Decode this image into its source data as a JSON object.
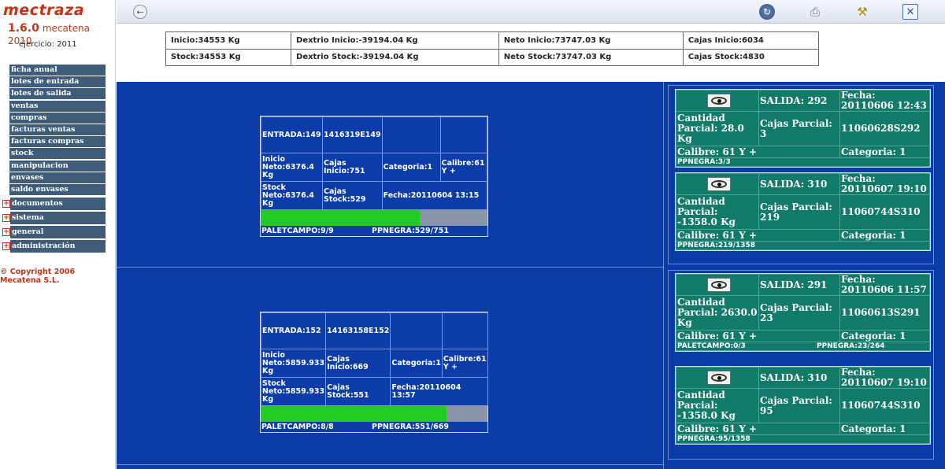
{
  "app": {
    "logo": "mectraza",
    "version": "1.6.0",
    "edition": "mecatena 2010",
    "ejercicio": "ejercicio: 2011"
  },
  "menu": {
    "items": [
      "ficha anual",
      "lotes de entrada",
      "lotes de salida",
      "ventas",
      "compras",
      "facturas ventas",
      "facturas compras",
      "stock",
      "manipulacion",
      "envases",
      "saldo envases"
    ],
    "groups": [
      "documentos",
      "sistema",
      "general",
      "administración"
    ]
  },
  "copyright": {
    "line1": "© Copyright 2006",
    "line2": "Mecatena S.L."
  },
  "summary": {
    "row1": [
      "Inicio:34553 Kg",
      "Dextrio Inicio:-39194.04 Kg",
      "Neto Inicio:73747.03 Kg",
      "Cajas Inicio:6034"
    ],
    "row2": [
      "Stock:34553 Kg",
      "Dextrio Stock:-39194.04 Kg",
      "Neto Stock:73747.03 Kg",
      "Cajas Stock:4830"
    ]
  },
  "entradas": [
    {
      "entrada": "ENTRADA:149",
      "codigo": "1416319E149",
      "inicio_neto": "Inicio Neto:6376.4 Kg",
      "cajas_inicio": "Cajas Inicio:751",
      "categoria": "Categoria:1",
      "calibre": "Calibre:61 Y +",
      "stock_neto": "Stock Neto:6376.4 Kg",
      "cajas_stock": "Cajas Stock:529",
      "fecha": "Fecha:20110604 13:15",
      "progress": 0.7,
      "paletcampo": "PALETCAMPO:9/9",
      "ppnegra": "PPNEGRA:529/751"
    },
    {
      "entrada": "ENTRADA:152",
      "codigo": "14163158E152",
      "inicio_neto": "Inicio Neto:5859.933 Kg",
      "cajas_inicio": "Cajas Inicio:669",
      "categoria": "Categoria:1",
      "calibre": "Calibre:61 Y +",
      "stock_neto": "Stock Neto:5859.933 Kg",
      "cajas_stock": "Cajas Stock:551",
      "fecha": "Fecha:20110604 13:57",
      "progress": 0.82,
      "paletcampo": "PALETCAMPO:8/8",
      "ppnegra": "PPNEGRA:551/669"
    }
  ],
  "salidas": [
    {
      "salida": "SALIDA: 292",
      "fecha": "Fecha: 20110606 12:43",
      "cantidad": "Cantidad Parcial: 28.0 Kg",
      "cajas": "Cajas Parcial: 3",
      "codigo": "11060628S292",
      "calibre": "Calibre: 61 Y +",
      "categoria": "Categoria: 1",
      "foot1": "PPNEGRA:3/3",
      "foot2": ""
    },
    {
      "salida": "SALIDA: 310",
      "fecha": "Fecha: 20110607 19:10",
      "cantidad": "Cantidad Parcial: -1358.0 Kg",
      "cajas": "Cajas Parcial: 219",
      "codigo": "11060744S310",
      "calibre": "Calibre: 61 Y +",
      "categoria": "Categoria: 1",
      "foot1": "PPNEGRA:219/1358",
      "foot2": ""
    },
    {
      "salida": "SALIDA: 291",
      "fecha": "Fecha: 20110606 11:57",
      "cantidad": "Cantidad Parcial: 2630.0 Kg",
      "cajas": "Cajas Parcial: 23",
      "codigo": "11060613S291",
      "calibre": "Calibre: 61 Y +",
      "categoria": "Categoria: 1",
      "foot1": "PALETCAMPO:0/3",
      "foot2": "PPNEGRA:23/264"
    },
    {
      "salida": "SALIDA: 310",
      "fecha": "Fecha: 20110607 19:10",
      "cantidad": "Cantidad Parcial: -1358.0 Kg",
      "cajas": "Cajas Parcial: 95",
      "codigo": "11060744S310",
      "calibre": "Calibre: 61 Y +",
      "categoria": "Categoria: 1",
      "foot1": "PPNEGRA:95/1358",
      "foot2": ""
    }
  ],
  "icons": {
    "back": "back-arrow-icon",
    "refresh": "refresh-icon",
    "print": "printer-icon",
    "tools": "tools-icon",
    "close": "close-icon",
    "eye": "eye-icon"
  },
  "colors": {
    "blue_bg": "#0b3ca8",
    "teal_card": "#117a68",
    "progress": "#22cc22",
    "brand": "#c83214",
    "menu_bg": "#3f5d7a"
  }
}
